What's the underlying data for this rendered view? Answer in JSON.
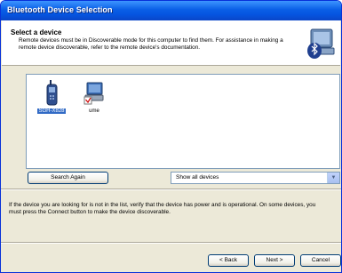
{
  "window": {
    "title": "Bluetooth Device Selection"
  },
  "header": {
    "title": "Select a device",
    "subtitle": "Remote devices must be in Discoverable mode for this computer to find them. For assistance in making a remote device discoverable, refer to the remote device's documentation.",
    "icon": "bluetooth-computer-icon"
  },
  "devices": [
    {
      "label": "SGH-X828",
      "icon": "phone-icon",
      "selected": true
    },
    {
      "label": "ume",
      "icon": "computer-icon",
      "selected": false
    }
  ],
  "controls": {
    "search_again_label": "Search Again",
    "filter_value": "Show all devices"
  },
  "info_text": "If the device you are looking for is not in the list, verify that the device has power and is operational. On some devices, you must press the Connect button to make the device discoverable.",
  "buttons": {
    "back": "< Back",
    "next": "Next >",
    "cancel": "Cancel"
  },
  "colors": {
    "title_bar": "#0554e0",
    "selection": "#316ac5",
    "dialog_bg": "#ece9d8"
  }
}
